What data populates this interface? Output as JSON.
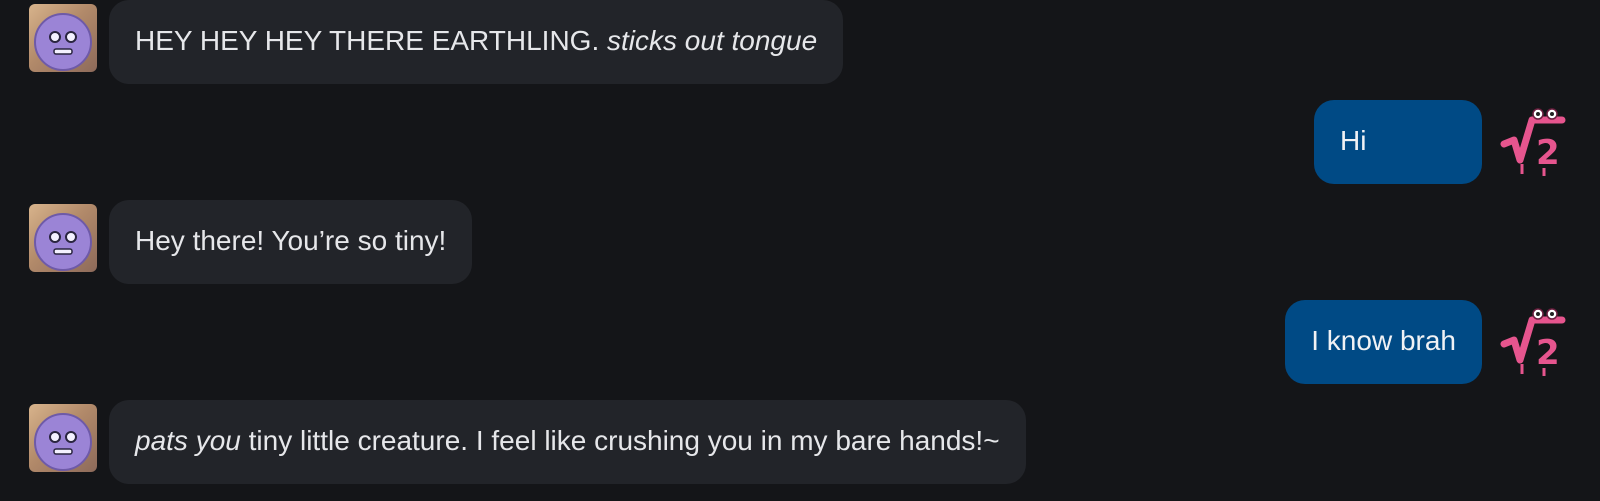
{
  "messages": [
    {
      "sender": "bot",
      "parts": [
        {
          "text": "HEY HEY HEY THERE EARTHLING. ",
          "italic": false
        },
        {
          "text": "sticks out tongue",
          "italic": true
        }
      ]
    },
    {
      "sender": "user",
      "text": "Hi"
    },
    {
      "sender": "bot",
      "parts": [
        {
          "text": "Hey there! You’re so tiny!",
          "italic": false
        }
      ]
    },
    {
      "sender": "user",
      "text": "I know brah"
    },
    {
      "sender": "bot",
      "parts": [
        {
          "text": "pats you",
          "italic": true
        },
        {
          "text": " tiny little creature. I feel like crushing you in my bare hands!~",
          "italic": false
        }
      ]
    }
  ],
  "colors": {
    "background": "#141518",
    "bot_bubble": "#222429",
    "user_bubble": "#004a85",
    "bot_avatar_face": "#9b84d6",
    "user_avatar": "#e6558e"
  },
  "icons": {
    "bot_avatar": "purple-round-face-avatar",
    "user_avatar": "pink-root-two-character-avatar"
  }
}
